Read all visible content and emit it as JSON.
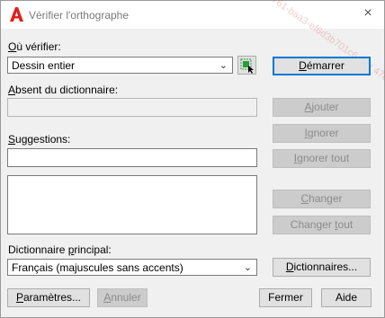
{
  "window": {
    "title": "Vérifier l'orthographe",
    "close_glyph": "×"
  },
  "watermark": "4761-baa3-ef6d3b701c6 test 4761 ff6a3 2b_6d3-4761-baa3-ef6d3b701c6 test",
  "where": {
    "label": "Où vérifier:",
    "value": "Dessin entier"
  },
  "not_in_dict": {
    "label": "Absent du dictionnaire:",
    "value": ""
  },
  "suggestions": {
    "label": "Suggestions:",
    "value": ""
  },
  "main_dict": {
    "label": "Dictionnaire principal:",
    "value": "Français (majuscules sans accents)"
  },
  "buttons": {
    "start": "Démarrer",
    "add": "Ajouter",
    "ignore": "Ignorer",
    "ignore_all": "Ignorer tout",
    "change": "Changer",
    "change_all": "Changer tout",
    "dictionaries": "Dictionnaires...",
    "settings": "Paramètres...",
    "undo": "Annuler",
    "close": "Fermer",
    "help": "Aide"
  },
  "icons": {
    "app": "autocad-icon",
    "select_objects": "select-objects-icon",
    "dropdown": "chevron-down-icon"
  },
  "colors": {
    "accent": "#0078d7",
    "app_red": "#e0201b",
    "select_green": "#2e9a3a"
  }
}
